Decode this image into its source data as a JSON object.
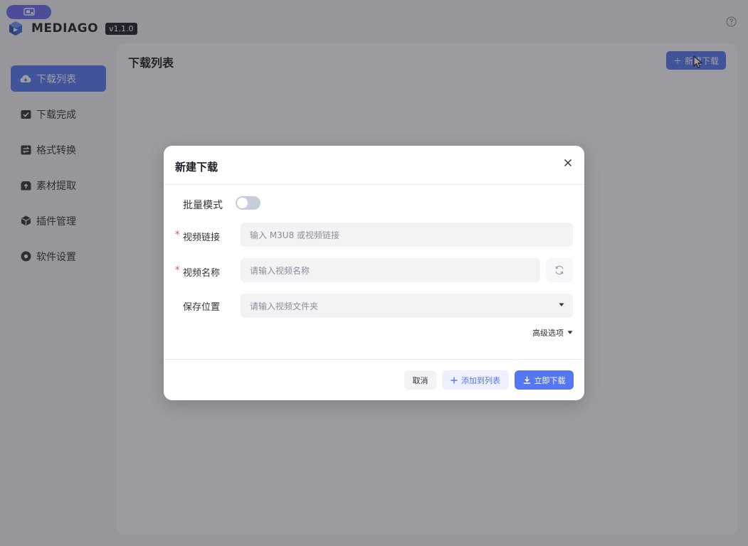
{
  "app": {
    "name": "MEDIAGO",
    "version": "v1.1.0"
  },
  "sidebar": {
    "items": [
      {
        "label": "下载列表",
        "icon": "cloud-download-icon",
        "active": true
      },
      {
        "label": "下载完成",
        "icon": "check-square-icon",
        "active": false
      },
      {
        "label": "格式转换",
        "icon": "convert-icon",
        "active": false
      },
      {
        "label": "素材提取",
        "icon": "extract-icon",
        "active": false
      },
      {
        "label": "插件管理",
        "icon": "plugin-cube-icon",
        "active": false
      },
      {
        "label": "软件设置",
        "icon": "settings-icon",
        "active": false
      }
    ]
  },
  "main": {
    "title": "下载列表",
    "new_button_label": "新建下载"
  },
  "modal": {
    "title": "新建下载",
    "batch_mode_label": "批量模式",
    "batch_mode_on": false,
    "video_link": {
      "label": "视频链接",
      "required": true,
      "placeholder": "输入 M3U8 或视频链接",
      "value": ""
    },
    "video_name": {
      "label": "视频名称",
      "required": true,
      "placeholder": "请输入视频名称",
      "value": ""
    },
    "save_location": {
      "label": "保存位置",
      "required": false,
      "placeholder": "请输入视频文件夹",
      "value": ""
    },
    "advanced_label": "高级选项",
    "footer": {
      "cancel_label": "取消",
      "add_to_list_label": "添加到列表",
      "download_now_label": "立即下载"
    }
  },
  "colors": {
    "accent": "#5577f2",
    "pill": "#6b6bf2",
    "required": "#e5484d"
  }
}
